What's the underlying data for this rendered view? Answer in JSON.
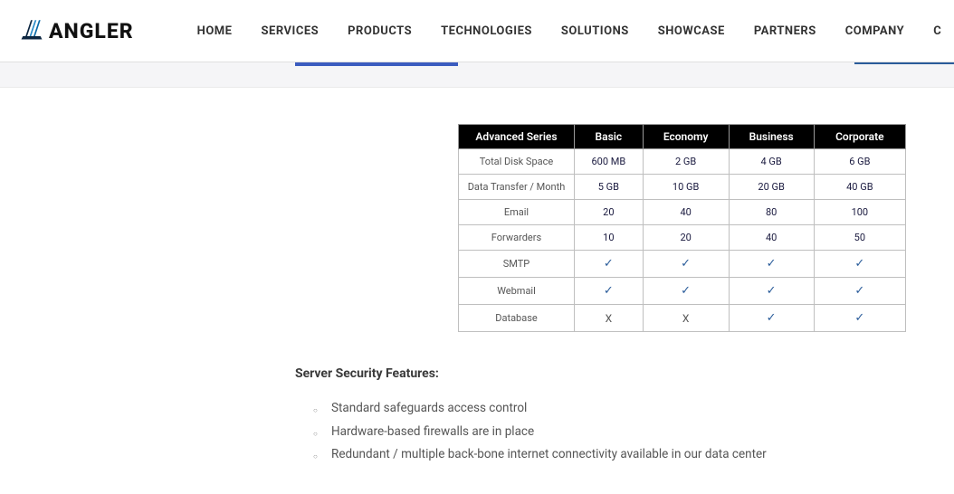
{
  "brand": "ANGLER",
  "nav": [
    "HOME",
    "SERVICES",
    "PRODUCTS",
    "TECHNOLOGIES",
    "SOLUTIONS",
    "SHOWCASE",
    "PARTNERS",
    "COMPANY",
    "C"
  ],
  "table": {
    "headers": [
      "Advanced Series",
      "Basic",
      "Economy",
      "Business",
      "Corporate"
    ],
    "rows": [
      {
        "label": "Total Disk Space",
        "cells": [
          "600 MB",
          "2 GB",
          "4 GB",
          "6 GB"
        ]
      },
      {
        "label": "Data Transfer / Month",
        "cells": [
          "5 GB",
          "10 GB",
          "20 GB",
          "40 GB"
        ]
      },
      {
        "label": "Email",
        "cells": [
          "20",
          "40",
          "80",
          "100"
        ]
      },
      {
        "label": "Forwarders",
        "cells": [
          "10",
          "20",
          "40",
          "50"
        ]
      },
      {
        "label": "SMTP",
        "cells": [
          "check",
          "check",
          "check",
          "check"
        ]
      },
      {
        "label": "Webmail",
        "cells": [
          "check",
          "check",
          "check",
          "check"
        ]
      },
      {
        "label": "Database",
        "cells": [
          "cross",
          "cross",
          "check",
          "check"
        ]
      }
    ]
  },
  "section_heading": "Server Security Features:",
  "features": [
    "Standard safeguards access control",
    "Hardware-based firewalls are in place",
    "Redundant / multiple back-bone internet connectivity available in our data center"
  ]
}
